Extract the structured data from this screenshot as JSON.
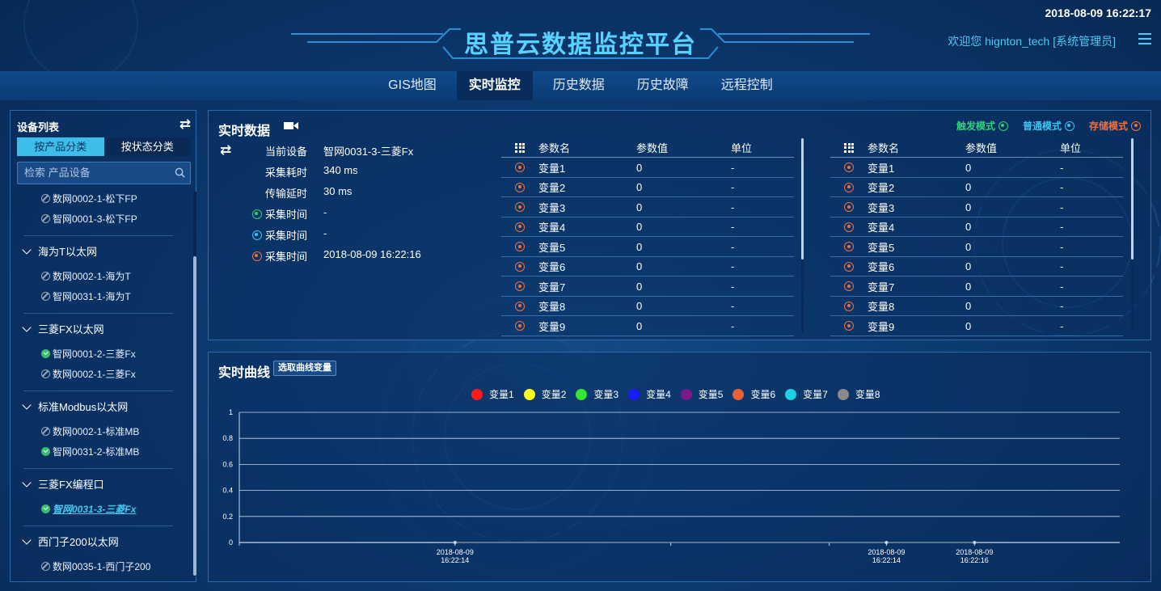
{
  "header": {
    "title": "思普云数据监控平台",
    "datetime": "2018-08-09 16:22:17",
    "welcome": "欢迎您  hignton_tech [系统管理员]"
  },
  "nav": {
    "tabs": [
      {
        "label": "GIS地图"
      },
      {
        "label": "实时监控"
      },
      {
        "label": "历史数据"
      },
      {
        "label": "历史故障"
      },
      {
        "label": "远程控制"
      }
    ],
    "active_index": 1
  },
  "sidebar": {
    "title": "设备列表",
    "tab_product": "按产品分类",
    "tab_status": "按状态分类",
    "search_placeholder": "检索 产品设备",
    "items": [
      {
        "type": "leaf",
        "label": "数网0002-1-松下FP",
        "status": "offline"
      },
      {
        "type": "leaf",
        "label": "智网0001-3-松下FP",
        "status": "offline"
      },
      {
        "type": "group",
        "label": "海为T以太网"
      },
      {
        "type": "leaf",
        "label": "数网0002-1-海为T",
        "status": "offline"
      },
      {
        "type": "leaf",
        "label": "智网0031-1-海为T",
        "status": "offline"
      },
      {
        "type": "group",
        "label": "三菱FX以太网"
      },
      {
        "type": "leaf",
        "label": "智网0001-2-三菱Fx",
        "status": "online"
      },
      {
        "type": "leaf",
        "label": "数网0002-1-三菱Fx",
        "status": "offline"
      },
      {
        "type": "group",
        "label": "标准Modbus以太网"
      },
      {
        "type": "leaf",
        "label": "数网0002-1-标准MB",
        "status": "offline"
      },
      {
        "type": "leaf",
        "label": "智网0031-2-标准MB",
        "status": "online"
      },
      {
        "type": "group",
        "label": "三菱FX编程口"
      },
      {
        "type": "leaf",
        "label": "智网0031-3-三菱Fx",
        "status": "online",
        "selected": true
      },
      {
        "type": "group",
        "label": "西门子200以太网"
      },
      {
        "type": "leaf",
        "label": "数网0035-1-西门子200",
        "status": "offline"
      }
    ]
  },
  "realtime": {
    "title": "实时数据",
    "modes": [
      {
        "label": "触发模式",
        "color": "#2fd07a"
      },
      {
        "label": "普通模式",
        "color": "#3cc3f0"
      },
      {
        "label": "存储模式",
        "color": "#f0703c"
      }
    ],
    "info": [
      {
        "label": "当前设备",
        "value": "智网0031-3-三菱Fx",
        "icon": "none"
      },
      {
        "label": "采集耗时",
        "value": "340 ms",
        "icon": "none"
      },
      {
        "label": "传输延时",
        "value": "30 ms",
        "icon": "none"
      },
      {
        "label": "采集时间",
        "value": "-",
        "icon": "trigger"
      },
      {
        "label": "采集时间",
        "value": "-",
        "icon": "normal"
      },
      {
        "label": "采集时间",
        "value": "2018-08-09 16:22:16",
        "icon": "storage"
      }
    ],
    "table_headers": [
      "参数名",
      "参数值",
      "单位"
    ],
    "table_left": [
      [
        "变量1",
        "0",
        "-"
      ],
      [
        "变量2",
        "0",
        "-"
      ],
      [
        "变量3",
        "0",
        "-"
      ],
      [
        "变量4",
        "0",
        "-"
      ],
      [
        "变量5",
        "0",
        "-"
      ],
      [
        "变量6",
        "0",
        "-"
      ],
      [
        "变量7",
        "0",
        "-"
      ],
      [
        "变量8",
        "0",
        "-"
      ],
      [
        "变量9",
        "0",
        "-"
      ]
    ],
    "table_right": [
      [
        "变量1",
        "0",
        "-"
      ],
      [
        "变量2",
        "0",
        "-"
      ],
      [
        "变量3",
        "0",
        "-"
      ],
      [
        "变量4",
        "0",
        "-"
      ],
      [
        "变量5",
        "0",
        "-"
      ],
      [
        "变量6",
        "0",
        "-"
      ],
      [
        "变量7",
        "0",
        "-"
      ],
      [
        "变量8",
        "0",
        "-"
      ],
      [
        "变量9",
        "0",
        "-"
      ]
    ]
  },
  "curve": {
    "title": "实时曲线",
    "select_button": "选取曲线变量"
  },
  "chart_data": {
    "type": "line",
    "title": "",
    "xlabel": "",
    "ylabel": "",
    "ylim": [
      0,
      1
    ],
    "yticks": [
      "0",
      "0.2",
      "0.4",
      "0.6",
      "0.8",
      "1"
    ],
    "x_ticks": [
      {
        "date": "2018-08-09",
        "time": "16:22:14"
      },
      {
        "date": "2018-08-09",
        "time": "16:22:14"
      },
      {
        "date": "2018-08-09",
        "time": "16:22:16"
      }
    ],
    "series": [
      {
        "name": "变量1",
        "color": "#ff1a1a",
        "values": [
          0,
          0,
          0
        ]
      },
      {
        "name": "变量2",
        "color": "#ffff1a",
        "values": [
          0,
          0,
          0
        ]
      },
      {
        "name": "变量3",
        "color": "#33e62e",
        "values": [
          0,
          0,
          0
        ]
      },
      {
        "name": "变量4",
        "color": "#1a1aff",
        "values": [
          0,
          0,
          0
        ]
      },
      {
        "name": "变量5",
        "color": "#7a1a8c",
        "values": [
          0,
          0,
          0
        ]
      },
      {
        "name": "变量6",
        "color": "#e8603a",
        "values": [
          0,
          0,
          0
        ]
      },
      {
        "name": "变量7",
        "color": "#1ecfe8",
        "values": [
          0,
          0,
          0
        ]
      },
      {
        "name": "变量8",
        "color": "#8a8a8a",
        "values": [
          0,
          0,
          0
        ]
      }
    ],
    "grid": true,
    "legend": "top"
  }
}
